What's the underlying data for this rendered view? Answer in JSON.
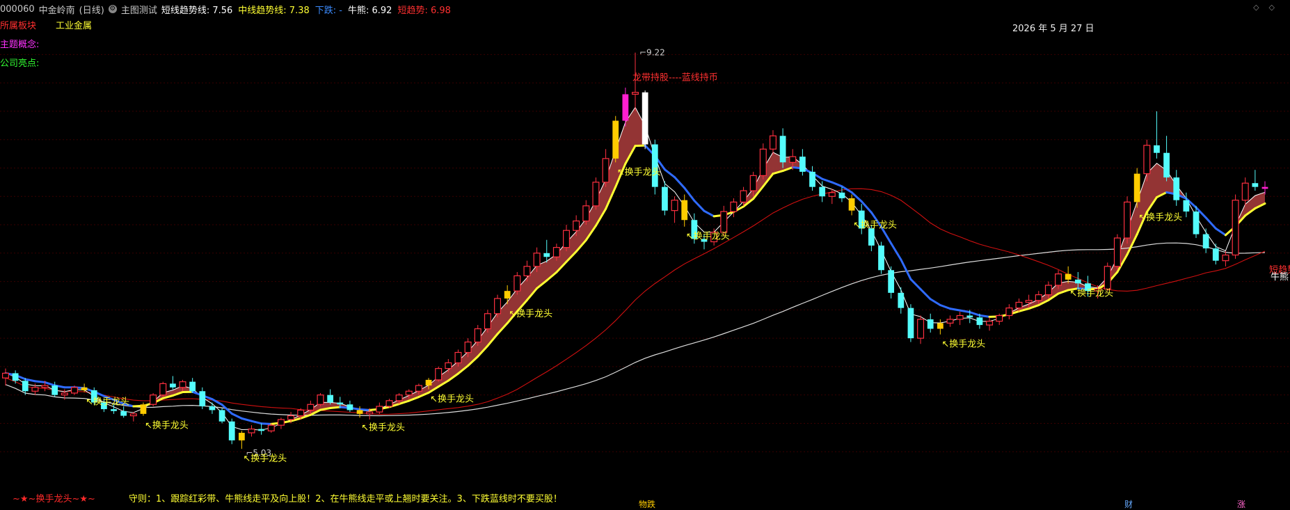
{
  "header": {
    "code": "000060",
    "name": "中金岭南",
    "period": "(日线)",
    "indicator_name": "主图测试",
    "items": [
      {
        "label": "短线趋势线:",
        "value": "7.56",
        "color": "#ffffff"
      },
      {
        "label": "中线趋势线:",
        "value": "7.38",
        "color": "#ffff33"
      },
      {
        "label": "下跌:",
        "value": "-",
        "color": "#3c8cff"
      },
      {
        "label": "牛熊:",
        "value": "6.92",
        "color": "#ffffff"
      },
      {
        "label": "短趋势:",
        "value": "6.98",
        "color": "#ff3030"
      }
    ]
  },
  "side_labels": {
    "sector_label": "所属板块",
    "sector_value": "工业金属",
    "concept_label": "主题概念:",
    "highlight_label": "公司亮点:"
  },
  "date_label": "2026 年 5 月 27 日",
  "rule_text": "守则：1、跟踪红彩带、牛熊线走平及向上股！2、在牛熊线走平或上翘时要关注。3、下跌蓝线时不要买股！",
  "footer_left": "~★~换手龙头~★~",
  "bottom_marks": [
    {
      "text": "物跌",
      "color": "#ffcc00"
    },
    {
      "text": "财",
      "color": "#66aaff"
    },
    {
      "text": "涨",
      "color": "#ff66cc"
    }
  ],
  "right_tags": {
    "short_trend": "短趋势",
    "bull_bear": "牛熊"
  },
  "chart_data": {
    "type": "candlestick",
    "price_range": [
      4.7,
      9.6
    ],
    "high_label": "9.22",
    "low_label": "5.03",
    "annotation": "龙带持股----蓝线持币",
    "signal_label": "换手龙头",
    "colors": {
      "up": "#ff3040",
      "down": "#54fcfc",
      "ribbon": "#a33a3a",
      "mid_trend": "#ffff33",
      "downtrend": "#2f6bff",
      "bull_bear": "#dddddd",
      "short_trend": "#d01010",
      "signal_bar": "#ffcc00",
      "magenta_bar": "#ff1fd0",
      "white_bar": "#ffffff"
    },
    "candles": [
      [
        5.78,
        5.88,
        5.7,
        5.83
      ],
      [
        5.83,
        5.86,
        5.72,
        5.75
      ],
      [
        5.75,
        5.78,
        5.6,
        5.64
      ],
      [
        5.64,
        5.72,
        5.6,
        5.68
      ],
      [
        5.68,
        5.75,
        5.64,
        5.7
      ],
      [
        5.7,
        5.74,
        5.58,
        5.6
      ],
      [
        5.6,
        5.66,
        5.55,
        5.62
      ],
      [
        5.62,
        5.7,
        5.6,
        5.68
      ],
      [
        5.68,
        5.72,
        5.63,
        5.65
      ],
      [
        5.65,
        5.68,
        5.5,
        5.52
      ],
      [
        5.52,
        5.56,
        5.42,
        5.45
      ],
      [
        5.45,
        5.5,
        5.4,
        5.43
      ],
      [
        5.43,
        5.48,
        5.36,
        5.38
      ],
      [
        5.38,
        5.42,
        5.32,
        5.4
      ],
      [
        5.4,
        5.52,
        5.38,
        5.5
      ],
      [
        5.5,
        5.62,
        5.48,
        5.6
      ],
      [
        5.6,
        5.74,
        5.58,
        5.72
      ],
      [
        5.72,
        5.8,
        5.66,
        5.68
      ],
      [
        5.68,
        5.76,
        5.64,
        5.74
      ],
      [
        5.74,
        5.78,
        5.62,
        5.64
      ],
      [
        5.64,
        5.68,
        5.45,
        5.48
      ],
      [
        5.48,
        5.52,
        5.4,
        5.44
      ],
      [
        5.44,
        5.46,
        5.3,
        5.32
      ],
      [
        5.32,
        5.35,
        5.08,
        5.12
      ],
      [
        5.12,
        5.22,
        5.03,
        5.2
      ],
      [
        5.2,
        5.28,
        5.16,
        5.24
      ],
      [
        5.24,
        5.3,
        5.18,
        5.22
      ],
      [
        5.22,
        5.3,
        5.2,
        5.28
      ],
      [
        5.28,
        5.36,
        5.24,
        5.34
      ],
      [
        5.34,
        5.42,
        5.3,
        5.38
      ],
      [
        5.38,
        5.46,
        5.34,
        5.44
      ],
      [
        5.44,
        5.54,
        5.4,
        5.5
      ],
      [
        5.5,
        5.62,
        5.48,
        5.6
      ],
      [
        5.6,
        5.66,
        5.5,
        5.52
      ],
      [
        5.52,
        5.58,
        5.46,
        5.5
      ],
      [
        5.5,
        5.54,
        5.42,
        5.44
      ],
      [
        5.44,
        5.48,
        5.36,
        5.4
      ],
      [
        5.4,
        5.46,
        5.34,
        5.42
      ],
      [
        5.42,
        5.52,
        5.4,
        5.48
      ],
      [
        5.48,
        5.56,
        5.46,
        5.54
      ],
      [
        5.54,
        5.62,
        5.5,
        5.6
      ],
      [
        5.6,
        5.66,
        5.56,
        5.64
      ],
      [
        5.64,
        5.72,
        5.6,
        5.7
      ],
      [
        5.7,
        5.78,
        5.66,
        5.76
      ],
      [
        5.76,
        5.9,
        5.74,
        5.88
      ],
      [
        5.88,
        5.98,
        5.84,
        5.94
      ],
      [
        5.94,
        6.08,
        5.9,
        6.05
      ],
      [
        6.05,
        6.2,
        6.0,
        6.16
      ],
      [
        6.16,
        6.34,
        6.12,
        6.3
      ],
      [
        6.3,
        6.5,
        6.26,
        6.46
      ],
      [
        6.46,
        6.66,
        6.42,
        6.62
      ],
      [
        6.62,
        6.76,
        6.56,
        6.7
      ],
      [
        6.7,
        6.9,
        6.66,
        6.86
      ],
      [
        6.86,
        7.02,
        6.8,
        6.96
      ],
      [
        6.96,
        7.16,
        6.9,
        7.1
      ],
      [
        7.1,
        7.24,
        7.0,
        7.06
      ],
      [
        7.06,
        7.2,
        7.02,
        7.16
      ],
      [
        7.16,
        7.4,
        7.12,
        7.34
      ],
      [
        7.34,
        7.5,
        7.28,
        7.44
      ],
      [
        7.44,
        7.66,
        7.4,
        7.6
      ],
      [
        7.6,
        7.9,
        7.56,
        7.85
      ],
      [
        7.85,
        8.2,
        7.8,
        8.1
      ],
      [
        8.1,
        8.55,
        8.06,
        8.5
      ],
      [
        8.5,
        8.85,
        8.44,
        8.78
      ],
      [
        8.78,
        9.22,
        8.6,
        8.8
      ],
      [
        8.8,
        8.82,
        8.2,
        8.25
      ],
      [
        8.25,
        8.3,
        7.72,
        7.8
      ],
      [
        7.8,
        7.86,
        7.5,
        7.55
      ],
      [
        7.55,
        7.7,
        7.42,
        7.66
      ],
      [
        7.66,
        7.72,
        7.38,
        7.45
      ],
      [
        7.45,
        7.52,
        7.2,
        7.25
      ],
      [
        7.25,
        7.3,
        7.14,
        7.22
      ],
      [
        7.22,
        7.36,
        7.18,
        7.32
      ],
      [
        7.32,
        7.6,
        7.28,
        7.54
      ],
      [
        7.54,
        7.68,
        7.48,
        7.64
      ],
      [
        7.64,
        7.8,
        7.6,
        7.76
      ],
      [
        7.76,
        7.96,
        7.7,
        7.92
      ],
      [
        7.92,
        8.26,
        7.88,
        8.2
      ],
      [
        8.2,
        8.4,
        8.14,
        8.34
      ],
      [
        8.34,
        8.42,
        8.0,
        8.06
      ],
      [
        8.06,
        8.2,
        7.98,
        8.12
      ],
      [
        8.12,
        8.2,
        7.92,
        7.96
      ],
      [
        7.96,
        8.02,
        7.76,
        7.8
      ],
      [
        7.8,
        7.86,
        7.64,
        7.7
      ],
      [
        7.7,
        7.78,
        7.62,
        7.74
      ],
      [
        7.74,
        7.8,
        7.64,
        7.68
      ],
      [
        7.68,
        7.72,
        7.5,
        7.55
      ],
      [
        7.55,
        7.62,
        7.3,
        7.36
      ],
      [
        7.36,
        7.4,
        7.12,
        7.18
      ],
      [
        7.18,
        7.22,
        6.88,
        6.92
      ],
      [
        6.92,
        6.96,
        6.62,
        6.68
      ],
      [
        6.68,
        6.74,
        6.46,
        6.52
      ],
      [
        6.52,
        6.56,
        6.16,
        6.2
      ],
      [
        6.2,
        6.44,
        6.14,
        6.4
      ],
      [
        6.4,
        6.46,
        6.26,
        6.3
      ],
      [
        6.3,
        6.4,
        6.24,
        6.36
      ],
      [
        6.36,
        6.44,
        6.32,
        6.4
      ],
      [
        6.4,
        6.48,
        6.34,
        6.44
      ],
      [
        6.44,
        6.5,
        6.36,
        6.42
      ],
      [
        6.42,
        6.46,
        6.3,
        6.34
      ],
      [
        6.34,
        6.42,
        6.28,
        6.38
      ],
      [
        6.38,
        6.46,
        6.34,
        6.44
      ],
      [
        6.44,
        6.56,
        6.4,
        6.52
      ],
      [
        6.52,
        6.62,
        6.48,
        6.58
      ],
      [
        6.58,
        6.66,
        6.52,
        6.6
      ],
      [
        6.6,
        6.7,
        6.56,
        6.66
      ],
      [
        6.66,
        6.8,
        6.62,
        6.76
      ],
      [
        6.76,
        6.92,
        6.72,
        6.88
      ],
      [
        6.88,
        6.96,
        6.78,
        6.82
      ],
      [
        6.82,
        6.9,
        6.72,
        6.78
      ],
      [
        6.78,
        6.86,
        6.64,
        6.7
      ],
      [
        6.7,
        6.76,
        6.62,
        6.72
      ],
      [
        6.72,
        7.0,
        6.7,
        6.96
      ],
      [
        6.96,
        7.3,
        6.92,
        7.26
      ],
      [
        7.26,
        7.7,
        7.2,
        7.64
      ],
      [
        7.64,
        8.0,
        7.58,
        7.94
      ],
      [
        7.94,
        8.3,
        7.86,
        8.24
      ],
      [
        8.24,
        8.6,
        8.1,
        8.16
      ],
      [
        8.16,
        8.34,
        7.86,
        7.9
      ],
      [
        7.9,
        7.98,
        7.6,
        7.66
      ],
      [
        7.66,
        7.74,
        7.48,
        7.54
      ],
      [
        7.54,
        7.6,
        7.26,
        7.3
      ],
      [
        7.3,
        7.36,
        7.1,
        7.15
      ],
      [
        7.15,
        7.2,
        6.98,
        7.02
      ],
      [
        7.02,
        7.12,
        6.96,
        7.08
      ],
      [
        7.08,
        7.72,
        7.04,
        7.66
      ],
      [
        7.66,
        7.9,
        7.6,
        7.84
      ],
      [
        7.84,
        7.98,
        7.76,
        7.8
      ],
      [
        7.8,
        7.86,
        7.72,
        7.78
      ]
    ],
    "signals": [
      8,
      14,
      24,
      36,
      43,
      51,
      62,
      69,
      86,
      95,
      108,
      115
    ]
  }
}
